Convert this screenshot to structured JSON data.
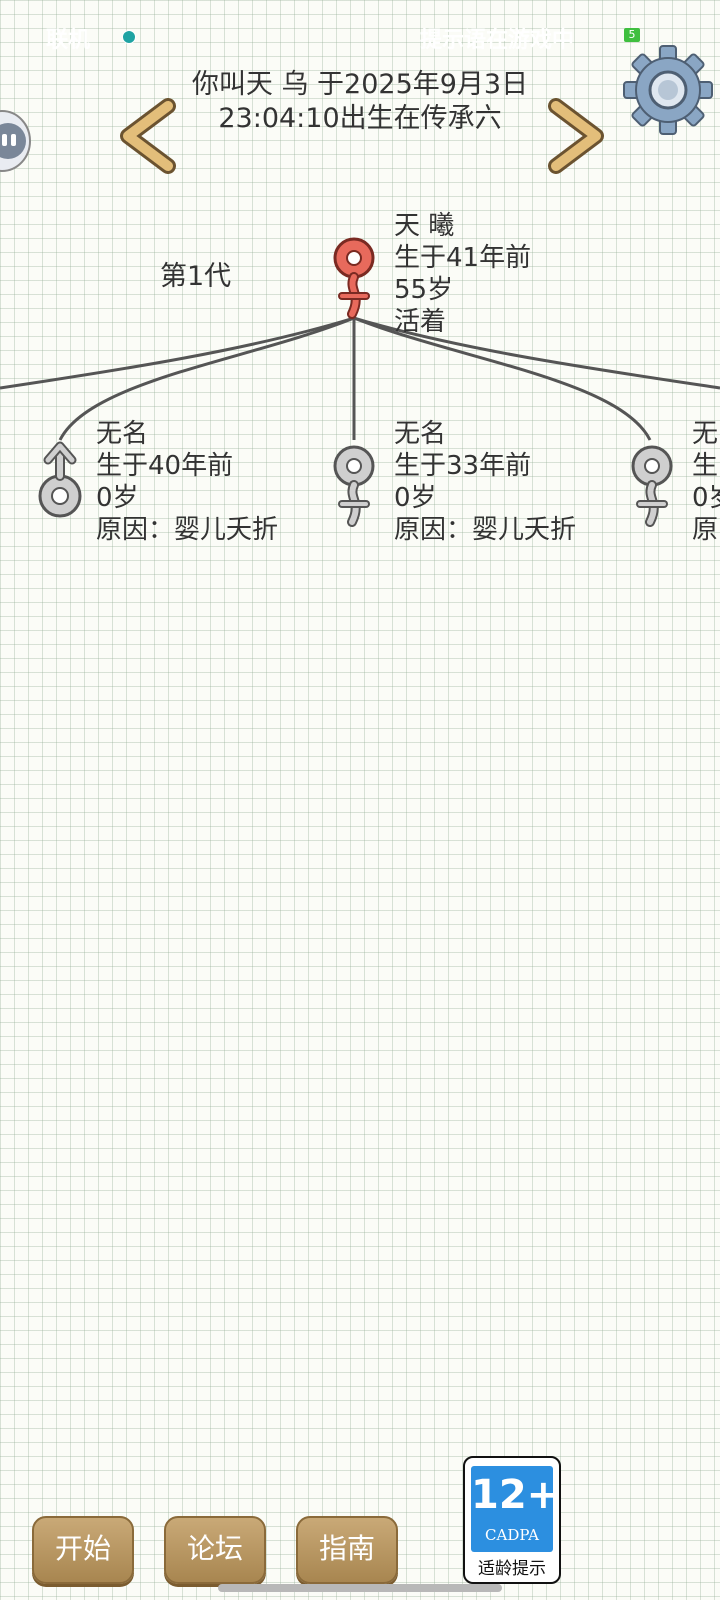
{
  "status_bar": {
    "left": "联机",
    "right": "提示语在游戏中",
    "battery": "5"
  },
  "header": {
    "line1": "你叫天 乌 于2025年9月3日",
    "line2": "23:04:10出生在传承六"
  },
  "generation_label": "第1代",
  "root": {
    "name": "天 曦",
    "born": "生于41年前",
    "age": "55岁",
    "status": "活着"
  },
  "children": [
    {
      "name": "无名",
      "born": "生于40年前",
      "age": "0岁",
      "status": "原因：婴儿夭折"
    },
    {
      "name": "无名",
      "born": "生于33年前",
      "age": "0岁",
      "status": "原因：婴儿夭折"
    },
    {
      "name": "无",
      "born": "生",
      "age": "0岁",
      "status": "原"
    }
  ],
  "buttons": {
    "start": "开始",
    "forum": "论坛",
    "guide": "指南"
  },
  "rating": {
    "age": "12+",
    "org": "CADPA",
    "tip": "适龄提示"
  },
  "colors": {
    "female_alive": "#d8504a",
    "deceased": "#c4c4c4",
    "button": "#b8956a",
    "rating_blue": "#2c8fe0"
  }
}
